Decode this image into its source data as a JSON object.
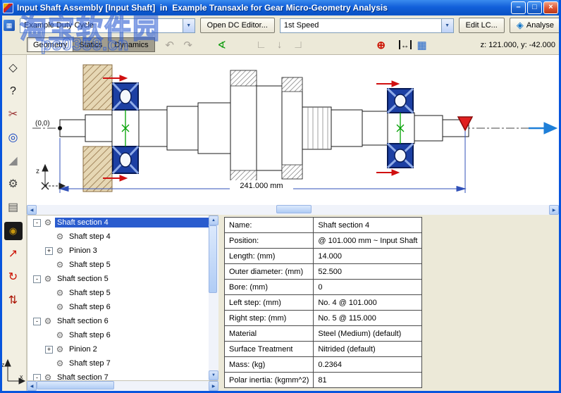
{
  "window": {
    "title": "Input Shaft Assembly [Input Shaft]  in  Example Transaxle for Gear Micro-Geometry Analysis",
    "controls": {
      "minimize": "–",
      "maximize": "□",
      "close": "×"
    }
  },
  "watermark": {
    "line1": "淘宝软件园",
    "line2": "pc0359.cn"
  },
  "toolbar": {
    "duty_cycle_value": "Example Duty Cycle",
    "open_dc_editor_label": "Open DC Editor...",
    "load_case_value": "1st Speed",
    "edit_lc_label": "Edit LC...",
    "analyse_label": "Analyse"
  },
  "ribbon": {
    "tabs": [
      {
        "label": "Geometry",
        "active": true
      },
      {
        "label": "Statics",
        "active": false
      },
      {
        "label": "Dynamics",
        "active": false
      }
    ],
    "coordinates": "z: 121.000, y: -42.000",
    "icons": [
      {
        "name": "undo-icon",
        "glyph": "↶",
        "color": "#A8A398"
      },
      {
        "name": "redo-icon",
        "glyph": "↷",
        "color": "#A8A398"
      },
      {
        "name": "measure-icon",
        "glyph": "∢",
        "color": "#0A9A0A"
      },
      {
        "name": "corner-left-icon",
        "glyph": "∟",
        "color": "#A8A398"
      },
      {
        "name": "snap-point-icon",
        "glyph": "↓",
        "color": "#A8A398"
      },
      {
        "name": "corner-right-icon",
        "glyph": "∟",
        "color": "#A8A398",
        "flip": true
      },
      {
        "name": "target-icon",
        "glyph": "⊕",
        "color": "#CC1100"
      },
      {
        "name": "fit-width-icon",
        "glyph": "↔",
        "color": "#111111"
      },
      {
        "name": "preview-icon",
        "glyph": "▦",
        "color": "#2266CC"
      }
    ]
  },
  "left_toolbar": {
    "icons": [
      {
        "name": "knife-tool-icon",
        "glyph": "◇",
        "color": "#222222"
      },
      {
        "name": "help-tool-icon",
        "glyph": "?",
        "color": "#111111"
      },
      {
        "name": "scissors-tool-icon",
        "glyph": "✂",
        "color": "#993333"
      },
      {
        "name": "sphere-tool-icon",
        "glyph": "◎",
        "color": "#1040C0"
      },
      {
        "name": "chamfer-tool-icon",
        "glyph": "◢",
        "color": "#8A8A8A"
      },
      {
        "name": "gear-tool-icon",
        "glyph": "⚙",
        "color": "#444444"
      },
      {
        "name": "shaft-tool-icon",
        "glyph": "▤",
        "color": "#555555"
      },
      {
        "name": "bearing-tool-icon",
        "glyph": "◉",
        "color": "#C8960C",
        "bg": "#1A1A1A"
      },
      {
        "name": "load-arrow-tool-icon",
        "glyph": "↗",
        "color": "#CC1100"
      },
      {
        "name": "rotate-tool-icon",
        "glyph": "↻",
        "color": "#CC1100"
      },
      {
        "name": "torque-tool-icon",
        "glyph": "⇅",
        "color": "#AA1100"
      }
    ]
  },
  "drawing": {
    "origin_label": "(0,0)",
    "dimension_label": "241.000 mm",
    "axis_z_label": "z",
    "axis_x_label": "x"
  },
  "tree": {
    "items": [
      {
        "label": "Shaft section 4",
        "level": 0,
        "expander": "-",
        "selected": true
      },
      {
        "label": "Shaft step 4",
        "level": 1,
        "expander": ""
      },
      {
        "label": "Pinion 3",
        "level": 1,
        "expander": "+"
      },
      {
        "label": "Shaft step 5",
        "level": 1,
        "expander": ""
      },
      {
        "label": "Shaft section 5",
        "level": 0,
        "expander": "-"
      },
      {
        "label": "Shaft step 5",
        "level": 1,
        "expander": ""
      },
      {
        "label": "Shaft step 6",
        "level": 1,
        "expander": ""
      },
      {
        "label": "Shaft section 6",
        "level": 0,
        "expander": "-"
      },
      {
        "label": "Shaft step 6",
        "level": 1,
        "expander": ""
      },
      {
        "label": "Pinion 2",
        "level": 1,
        "expander": "+"
      },
      {
        "label": "Shaft step 7",
        "level": 1,
        "expander": ""
      },
      {
        "label": "Shaft section 7",
        "level": 0,
        "expander": "-"
      }
    ]
  },
  "properties": {
    "rows": [
      {
        "label": "Name:",
        "value": "Shaft section 4"
      },
      {
        "label": "Position:",
        "value": "@ 101.000 mm ~ Input Shaft"
      },
      {
        "label": "Length: (mm)",
        "value": "14.000"
      },
      {
        "label": "Outer diameter: (mm)",
        "value": "52.500"
      },
      {
        "label": "Bore: (mm)",
        "value": "0"
      },
      {
        "label": "Left step: (mm)",
        "value": "No. 4 @ 101.000"
      },
      {
        "label": "Right step: (mm)",
        "value": "No. 5 @ 115.000"
      },
      {
        "label": "Material",
        "value": "Steel (Medium) (default)"
      },
      {
        "label": "Surface Treatment",
        "value": "Nitrided (default)"
      },
      {
        "label": "Mass: (kg)",
        "value": "0.2364"
      },
      {
        "label": "Polar inertia: (kgmm^2)",
        "value": "81"
      }
    ]
  }
}
